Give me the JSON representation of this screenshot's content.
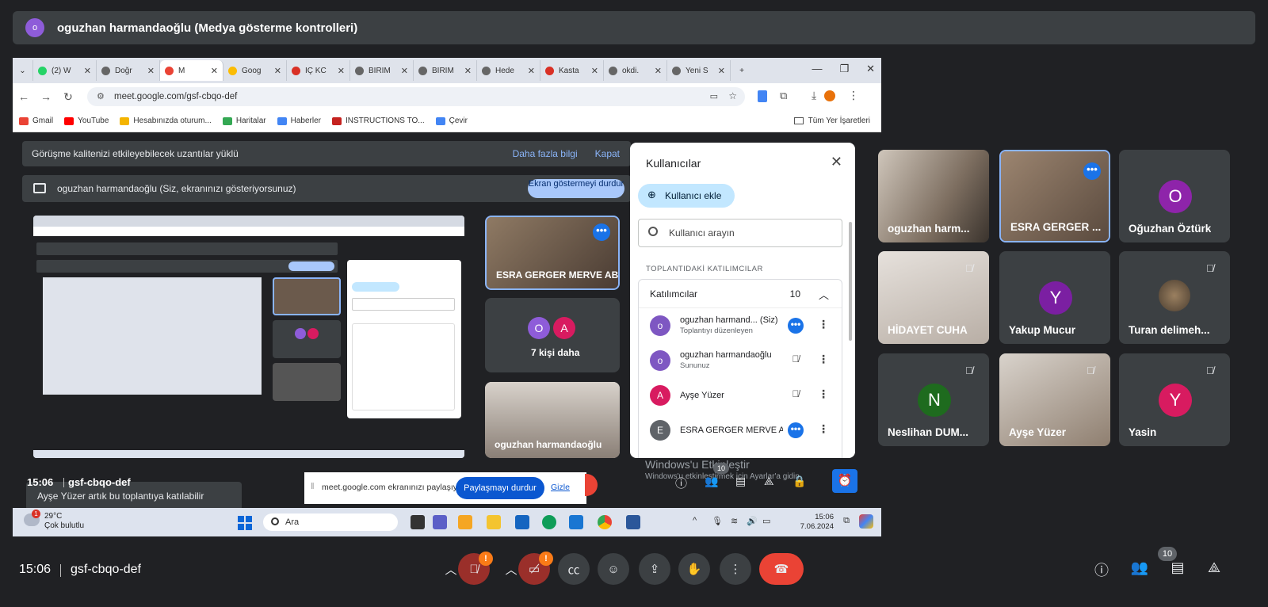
{
  "banner": {
    "avatar": "o",
    "title": "oguzhan harmandaoğlu (Medya gösterme kontrolleri)"
  },
  "browser": {
    "tabs": [
      {
        "label": "(2) W",
        "color": "#25d366"
      },
      {
        "label": "Doğr",
        "color": "#666666"
      },
      {
        "label": "M",
        "color": "#ea4335"
      },
      {
        "label": "Goog",
        "color": "#fbbc04"
      },
      {
        "label": "İÇ KC",
        "color": "#d93025"
      },
      {
        "label": "BİRİM",
        "color": "#666666"
      },
      {
        "label": "BİRİM",
        "color": "#666666"
      },
      {
        "label": "Hede",
        "color": "#666666"
      },
      {
        "label": "Kasta",
        "color": "#d93025"
      },
      {
        "label": "okdi.",
        "color": "#666666"
      },
      {
        "label": "Yeni S",
        "color": "#666666"
      }
    ],
    "new_tab": "+",
    "url": "meet.google.com/gsf-cbqo-def",
    "bookmarks": [
      {
        "label": "Gmail",
        "color": "#ea4335"
      },
      {
        "label": "YouTube",
        "color": "#ff0000"
      },
      {
        "label": "Hesabınızda oturum...",
        "color": "#f4b400"
      },
      {
        "label": "Haritalar",
        "color": "#34a853"
      },
      {
        "label": "Haberler",
        "color": "#4285f4"
      },
      {
        "label": "INSTRUCTIONS TO...",
        "color": "#c5221f"
      },
      {
        "label": "Çevir",
        "color": "#4285f4"
      }
    ],
    "all_bookmarks": "Tüm Yer İşaretleri"
  },
  "meet_inner": {
    "warning": "Görüşme kalitenizi etkileyebilecek uzantılar yüklü",
    "warning_more": "Daha fazla bilgi",
    "warning_close": "Kapat",
    "presenting": "oguzhan harmandaoğlu (Siz, ekranınızı gösteriyorsunuz)",
    "stop_presenting": "Ekran göstermeyi durdur",
    "tiles": [
      {
        "name": "ESRA GERGER MERVE AB..."
      },
      {
        "name": "7 kişi daha",
        "avatars": [
          "O",
          "A"
        ]
      },
      {
        "name": "oguzhan harmandaoğlu"
      }
    ],
    "toast": "Ayşe Yüzer artık bu toplantıya katılabilir",
    "time": "15:06",
    "code": "gsf-cbqo-def",
    "sharing_text": "meet.google.com ekranınızı paylaşıyor.",
    "stop_sharing": "Paylaşmayı durdur",
    "hide": "Gizle",
    "people_count": "10",
    "windows_activate": "Windows'u Etkinleştir",
    "windows_activate_sub": "Windows'u etkinleştirmek için Ayarlar'a gidin."
  },
  "users_panel": {
    "title": "Kullanıcılar",
    "add_user": "Kullanıcı ekle",
    "search_placeholder": "Kullanıcı arayın",
    "section": "TOPLANTIDAKİ KATILIMCILAR",
    "participants_label": "Katılımcılar",
    "participants_count": "10",
    "rows": [
      {
        "avatar": "o",
        "color": "#7e57c2",
        "name": "oguzhan harmand...",
        "suffix": "(Siz)",
        "sub": "Toplantıyı düzenleyen"
      },
      {
        "avatar": "o",
        "color": "#7e57c2",
        "name": "oguzhan harmandaoğlu",
        "suffix": "",
        "sub": "Sununuz"
      },
      {
        "avatar": "A",
        "color": "#d81b60",
        "name": "Ayşe Yüzer",
        "suffix": "",
        "sub": ""
      },
      {
        "avatar": "E",
        "color": "#5f6368",
        "name": "ESRA GERGER MERVE A...",
        "suffix": "",
        "sub": ""
      }
    ]
  },
  "taskbar": {
    "weather_badge": "1",
    "temp": "29°C",
    "condition": "Çok bulutlu",
    "search": "Ara",
    "time": "15:06",
    "date": "7.06.2024"
  },
  "bottom": {
    "time": "15:06",
    "code": "gsf-cbqo-def",
    "people_count": "10",
    "warn": "!"
  },
  "grid": [
    {
      "name": "oguzhan harm...",
      "type": "photo"
    },
    {
      "name": "ESRA GERGER ...",
      "type": "photo",
      "active": true
    },
    {
      "name": "Oğuzhan Öztürk",
      "type": "avatar",
      "letter": "O",
      "color": "#8e24aa"
    },
    {
      "name": "HİDAYET CUHA",
      "type": "photo",
      "muted": true
    },
    {
      "name": "Yakup Mucur",
      "type": "avatar",
      "letter": "Y",
      "color": "#7b1fa2"
    },
    {
      "name": "Turan delimeh...",
      "type": "smallphoto",
      "muted": true
    },
    {
      "name": "Neslihan DUM...",
      "type": "avatar",
      "letter": "N",
      "color": "#1e6b1e",
      "muted": true
    },
    {
      "name": "Ayşe Yüzer",
      "type": "photo",
      "muted": true
    },
    {
      "name": "Yasin",
      "type": "avatar",
      "letter": "Y",
      "color": "#d81b60",
      "muted": true
    }
  ]
}
